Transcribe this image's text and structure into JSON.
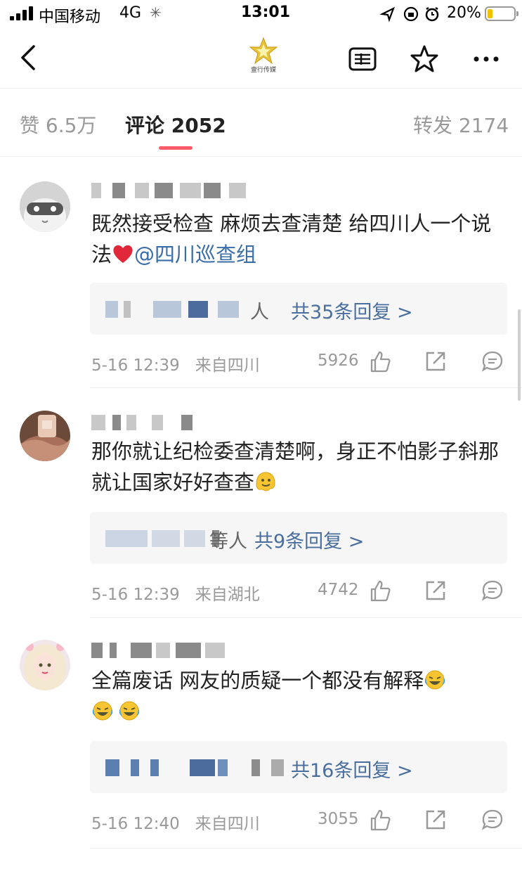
{
  "status_bar": {
    "carrier": "中国移动",
    "network": "4G",
    "time": "13:01",
    "battery_percent": "20%",
    "battery_level": 0.2
  },
  "nav": {
    "logo_text": "壹行传媒",
    "icons": [
      "back-icon",
      "article-icon",
      "star-icon",
      "more-icon"
    ]
  },
  "tabs": [
    {
      "label": "赞 6.5万",
      "active": false
    },
    {
      "label": "评论 2052",
      "active": true
    },
    {
      "label": "转发 2174",
      "active": false
    }
  ],
  "comments": [
    {
      "text": "既然接受检查  麻烦去查清楚 给四川人一个说法",
      "mention": "@四川巡查组",
      "emoji": "heart",
      "reply_suffix": "人",
      "reply_count": "共35条回复 >",
      "date": "5-16 12:39",
      "location": "来自四川",
      "likes": "5926"
    },
    {
      "text": "那你就让纪检委查清楚啊，身正不怕影子斜那就让国家好好查查",
      "emoji": "melting-face",
      "reply_suffix": "等人",
      "reply_count": "共9条回复 >",
      "date": "5-16 12:39",
      "location": "来自湖北",
      "likes": "4742"
    },
    {
      "text": "全篇废话 网友的质疑一个都没有解释",
      "emoji": "laughing-crying",
      "reply_suffix": "",
      "reply_count": "共16条回复 >",
      "date": "5-16 12:40",
      "location": "来自四川",
      "likes": "3055"
    }
  ],
  "colors": {
    "accent": "#ff5b6b",
    "link": "#3a6ea8",
    "reply_link": "#4a6f9e",
    "meta_gray": "#999999"
  }
}
